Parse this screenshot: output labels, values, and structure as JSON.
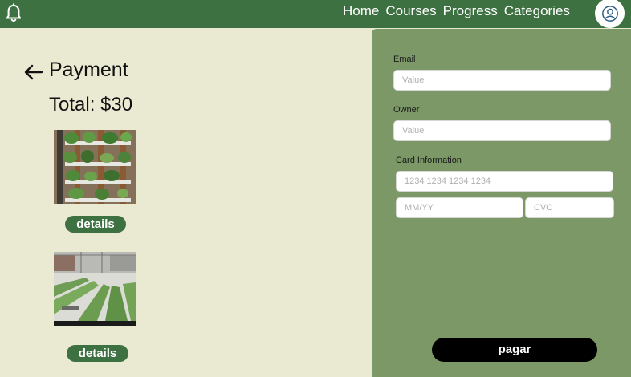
{
  "header": {
    "nav": [
      {
        "label": "Home"
      },
      {
        "label": "Courses"
      },
      {
        "label": "Progress"
      },
      {
        "label": "Categories"
      }
    ]
  },
  "payment": {
    "title": "Payment",
    "total": "Total: $30",
    "items": [
      {
        "details_label": "details"
      },
      {
        "details_label": "details"
      }
    ]
  },
  "form": {
    "email_label": "Email",
    "email_placeholder": "Value",
    "owner_label": "Owner",
    "owner_placeholder": "Value",
    "card_label": "Card Information",
    "card_number_placeholder": "1234 1234 1234 1234",
    "expiry_placeholder": "MM/YY",
    "cvc_placeholder": "CVC",
    "submit_label": "pagar"
  },
  "colors": {
    "header_bg": "#3e7142",
    "page_bg": "#eaead3",
    "panel_bg": "#7b9866",
    "button_green": "#3e7142",
    "pay_button": "#000000"
  }
}
